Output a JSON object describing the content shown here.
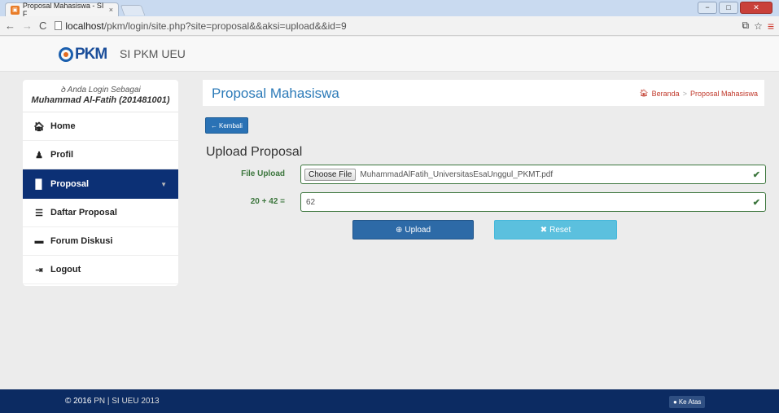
{
  "browser": {
    "tab_title": "Proposal Mahasiswa - SI F",
    "tab_close": "×",
    "url_host": "localhost",
    "url_path": "/pkm/login/site.php?site=proposal&&aksi=upload&&id=9",
    "minimize": "−",
    "maximize": "□",
    "close": "✕"
  },
  "header": {
    "logo_text": "PKM",
    "site_name": "SI PKM UEU"
  },
  "sidebar": {
    "login_text": "Anda Login Sebagai",
    "user_name": "Muhammad Al-Fatih (201481001)",
    "items": [
      {
        "label": "Home",
        "icon": "home-icon"
      },
      {
        "label": "Profil",
        "icon": "user-icon"
      },
      {
        "label": "Proposal",
        "icon": "file-icon",
        "active": true
      },
      {
        "label": "Daftar Proposal",
        "icon": "list-icon"
      },
      {
        "label": "Forum Diskusi",
        "icon": "comment-icon"
      },
      {
        "label": "Logout",
        "icon": "logout-icon"
      }
    ]
  },
  "main": {
    "page_title": "Proposal Mahasiswa",
    "breadcrumb": [
      "Beranda",
      "Proposal Mahasiswa"
    ],
    "back_label": "Kembali",
    "section_title": "Upload Proposal",
    "form": {
      "file_label": "File Upload",
      "choose_label": "Choose File",
      "file_name": "MuhammadAlFatih_UniversitasEsaUnggul_PKMT.pdf",
      "captcha_label": "20 + 42 =",
      "captcha_value": "62"
    },
    "upload_label": "Upload",
    "reset_label": "Reset"
  },
  "footer": {
    "copyright_year": "© 2016",
    "copyright_rest": "PN | SI UEU 2013",
    "top_label": "Ke Atas"
  },
  "colors": {
    "nav_active": "#0c3075",
    "footer": "#0c2b62",
    "title": "#2b7ab8",
    "success": "#3c763d",
    "upload": "#2d6aa7",
    "reset": "#5bc0de"
  }
}
